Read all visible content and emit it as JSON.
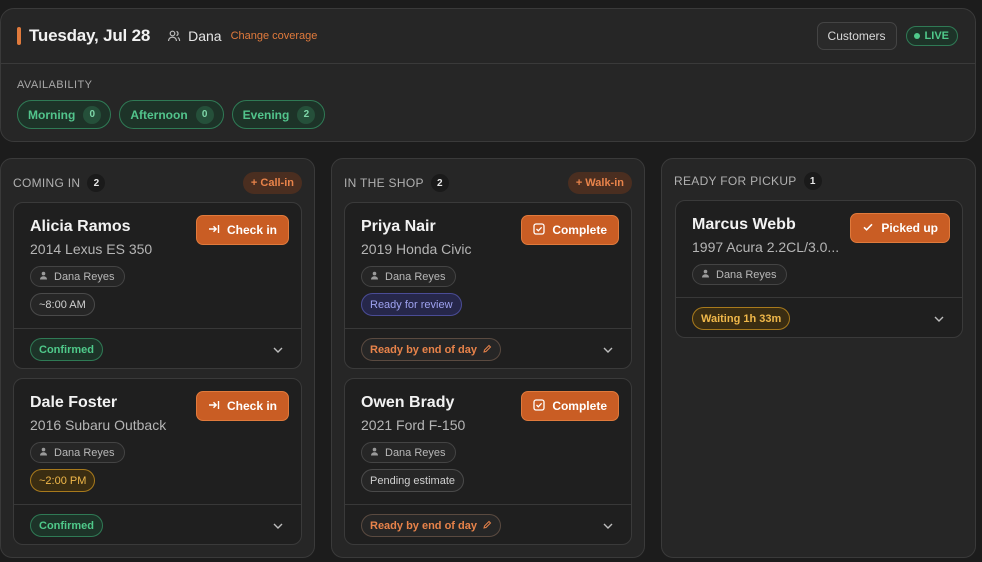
{
  "header": {
    "date": "Tuesday, Jul 28",
    "user": "Dana",
    "change_coverage": "Change coverage",
    "customers_label": "Customers",
    "live_label": "LIVE"
  },
  "availability": {
    "label": "AVAILABILITY",
    "slots": [
      {
        "label": "Morning",
        "count": "0"
      },
      {
        "label": "Afternoon",
        "count": "0"
      },
      {
        "label": "Evening",
        "count": "2"
      }
    ]
  },
  "columns": [
    {
      "title": "COMING IN",
      "count": "2",
      "action": "+ Call-in",
      "cards": [
        {
          "name": "Alicia Ramos",
          "vehicle": "2014 Lexus ES 350",
          "action": "Check in",
          "tech": "Dana Reyes",
          "tag": "~8:00 AM",
          "status": "Confirmed"
        },
        {
          "name": "Dale Foster",
          "vehicle": "2016 Subaru Outback",
          "action": "Check in",
          "tech": "Dana Reyes",
          "tag": "~2:00 PM",
          "status": "Confirmed"
        }
      ]
    },
    {
      "title": "IN THE SHOP",
      "count": "2",
      "action": "+ Walk-in",
      "cards": [
        {
          "name": "Priya Nair",
          "vehicle": "2019 Honda Civic",
          "action": "Complete",
          "tech": "Dana Reyes",
          "tag": "Ready for review",
          "status": "Ready by end of day"
        },
        {
          "name": "Owen Brady",
          "vehicle": "2021 Ford F-150",
          "action": "Complete",
          "tech": "Dana Reyes",
          "tag": "Pending estimate",
          "status": "Ready by end of day"
        }
      ]
    },
    {
      "title": "READY FOR PICKUP",
      "count": "1",
      "cards": [
        {
          "name": "Marcus Webb",
          "vehicle": "1997 Acura 2.2CL/3.0...",
          "action": "Picked up",
          "tech": "Dana Reyes",
          "status": "Waiting 1h 33m"
        }
      ]
    }
  ],
  "colors": {
    "accent": "#e07a3c",
    "action_button": "#c95d24",
    "success": "#4fc98a",
    "warning": "#f0b84a",
    "info": "#9ea2f0"
  },
  "icons": {
    "user": "users-icon",
    "check_in": "arrow-to-line-icon",
    "complete": "checkbox-icon",
    "picked_up": "check-icon",
    "tech": "person-icon",
    "edit": "pencil-icon",
    "expand": "chevron-down-icon"
  }
}
